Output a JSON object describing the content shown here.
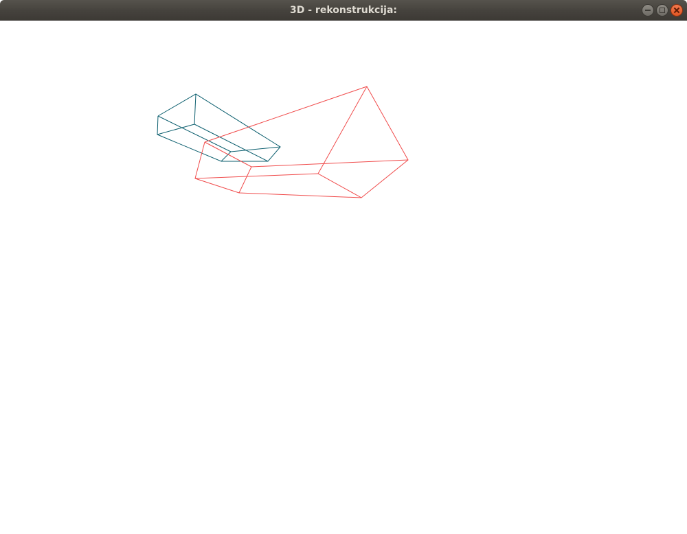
{
  "window": {
    "title": "3D - rekonstrukcija:"
  },
  "controls": {
    "minimize": "minimize-icon",
    "maximize": "maximize-icon",
    "close": "close-icon"
  },
  "colors": {
    "titlebar": "#45423d",
    "title_text": "#dfdbd2",
    "teal_wireframe": "#0b5e6e",
    "red_wireframe": "#f04a4a",
    "background": "#ffffff"
  }
}
